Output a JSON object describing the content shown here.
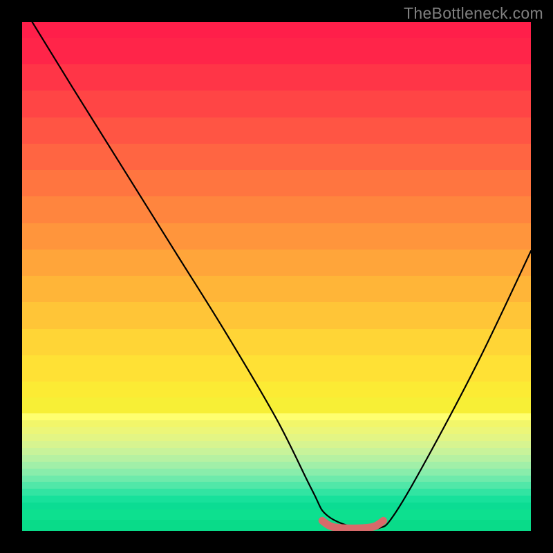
{
  "watermark": "TheBottleneck.com",
  "chart_data": {
    "type": "line",
    "title": "",
    "xlabel": "",
    "ylabel": "",
    "xlim": [
      0,
      100
    ],
    "ylim": [
      0,
      100
    ],
    "series": [
      {
        "name": "bottleneck-curve",
        "x": [
          2,
          10,
          20,
          30,
          40,
          50,
          57,
          60,
          66,
          70,
          73,
          80,
          90,
          100
        ],
        "values": [
          100,
          87,
          71,
          55,
          39,
          22,
          8,
          3,
          0.5,
          0.5,
          3,
          15,
          34,
          55
        ]
      },
      {
        "name": "optimal-range-marker",
        "x": [
          59,
          61,
          65,
          69,
          71
        ],
        "values": [
          2,
          0.8,
          0.5,
          0.8,
          2
        ]
      }
    ],
    "gradient_bands": [
      {
        "color": "#ff1f4a",
        "height_pct": 3
      },
      {
        "color": "#ff2549",
        "height_pct": 5
      },
      {
        "color": "#ff3547",
        "height_pct": 5
      },
      {
        "color": "#ff4545",
        "height_pct": 5
      },
      {
        "color": "#ff5544",
        "height_pct": 5
      },
      {
        "color": "#ff6542",
        "height_pct": 5
      },
      {
        "color": "#ff7540",
        "height_pct": 5
      },
      {
        "color": "#ff853e",
        "height_pct": 5
      },
      {
        "color": "#ff953c",
        "height_pct": 5
      },
      {
        "color": "#ffa53a",
        "height_pct": 5
      },
      {
        "color": "#ffb538",
        "height_pct": 5
      },
      {
        "color": "#ffc537",
        "height_pct": 5
      },
      {
        "color": "#ffd536",
        "height_pct": 5
      },
      {
        "color": "#ffe135",
        "height_pct": 5
      },
      {
        "color": "#fceb34",
        "height_pct": 3
      },
      {
        "color": "#f7ef36",
        "height_pct": 3
      },
      {
        "color": "#ffff70",
        "height_pct": 1.3
      },
      {
        "color": "#f2f66a",
        "height_pct": 1.3
      },
      {
        "color": "#ecf678",
        "height_pct": 1.3
      },
      {
        "color": "#e3f584",
        "height_pct": 1.3
      },
      {
        "color": "#d7f490",
        "height_pct": 1.3
      },
      {
        "color": "#c8f39a",
        "height_pct": 1.3
      },
      {
        "color": "#b6f1a2",
        "height_pct": 1.3
      },
      {
        "color": "#a1efa8",
        "height_pct": 1.3
      },
      {
        "color": "#89edab",
        "height_pct": 1.3
      },
      {
        "color": "#6eeaab",
        "height_pct": 1.3
      },
      {
        "color": "#51e7a8",
        "height_pct": 1.3
      },
      {
        "color": "#32e4a2",
        "height_pct": 1.3
      },
      {
        "color": "#17e19b",
        "height_pct": 1.3
      },
      {
        "color": "#0bdc93",
        "height_pct": 1.3
      },
      {
        "color": "#0de08f",
        "height_pct": 2
      },
      {
        "color": "#09db89",
        "height_pct": 2
      }
    ],
    "curve_color": "#000000",
    "marker_color": "#d76a6a"
  }
}
